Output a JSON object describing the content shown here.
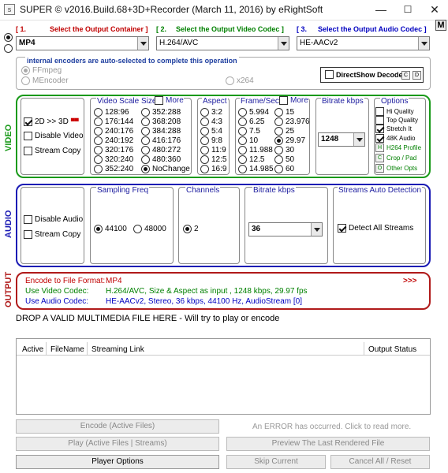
{
  "window": {
    "title": "SUPER © v2016.Build.68+3D+Recorder (March 11, 2016) by eRightSoft",
    "minimize": "—",
    "maximize": "☐",
    "close": "✕",
    "m_label": "M",
    "icon": "s"
  },
  "output_container": {
    "num": "[ 1.",
    "label": "Select the Output Container ]",
    "value": "MP4"
  },
  "video_codec": {
    "num": "[ 2.",
    "label": "Select the Output Video Codec ]",
    "value": "H.264/AVC"
  },
  "audio_codec": {
    "num": "[ 3.",
    "label": "Select the Output Audio Codec ]",
    "value": "HE-AACv2"
  },
  "encoders": {
    "title": "internal encoders are auto-selected to complete this operation",
    "ffmpeg": "FFmpeg",
    "mencoder": "MEncoder",
    "x264": "x264",
    "directshow": "DirectShow Decode",
    "mini_c": "C",
    "mini_d": "D"
  },
  "video": {
    "label": "VIDEO",
    "options": {
      "mode3d": "2D >> 3D",
      "disable": "Disable Video",
      "copy": "Stream Copy"
    },
    "scale": {
      "title": "Video Scale Size",
      "more": "More",
      "col1": [
        "128:96",
        "176:144",
        "240:176",
        "240:192",
        "320:176",
        "320:240",
        "352:240"
      ],
      "col2": [
        "352:288",
        "368:208",
        "384:288",
        "416:176",
        "480:272",
        "480:360",
        "NoChange"
      ]
    },
    "aspect": {
      "title": "Aspect",
      "values": [
        "3:2",
        "4:3",
        "5:4",
        "9:8",
        "11:9",
        "12:5",
        "16:9"
      ]
    },
    "framerate": {
      "title": "Frame/Sec",
      "more": "More",
      "col1": [
        "5.994",
        "6.25",
        "7.5",
        "10",
        "11.988",
        "12.5",
        "14.985"
      ],
      "col2": [
        "15",
        "23.976",
        "25",
        "29.97",
        "30",
        "50",
        "60"
      ]
    },
    "bitrate": {
      "title": "Bitrate  kbps",
      "value": "1248"
    },
    "opts": {
      "title": "Options",
      "hiq": "Hi Quality",
      "topq": "Top Quality",
      "stretch": "Stretch It",
      "audio48": "48K Audio",
      "h264": "H264 Profile",
      "crop": "Crop / Pad",
      "other": "Other Opts",
      "h": "H",
      "c": "C",
      "o": "O"
    }
  },
  "audio": {
    "label": "AUDIO",
    "disable": "Disable Audio",
    "copy": "Stream Copy",
    "freq": {
      "title": "Sampling Freq",
      "a": "44100",
      "b": "48000"
    },
    "channels": {
      "title": "Channels",
      "value": "2"
    },
    "bitrate": {
      "title": "Bitrate  kbps",
      "value": "36"
    },
    "streams": {
      "title": "Streams Auto Detection",
      "detect": "Detect All Streams"
    }
  },
  "output": {
    "label": "OUTPUT",
    "rows": [
      {
        "label": "Encode to File Format:",
        "value": "MP4"
      },
      {
        "label": "Use Video Codec:",
        "value": "H.264/AVC,   Size & Aspect as input ,   1248 kbps,   29.97 fps"
      },
      {
        "label": "Use Audio Codec:",
        "value": "HE-AACv2,   Stereo,   36 kbps,   44100 Hz,   AudioStream [0]"
      }
    ],
    "more": ">>>"
  },
  "drop_text": "DROP A VALID MULTIMEDIA FILE HERE - Will try to play or encode",
  "table": {
    "cols": [
      "Active",
      "FileName",
      "Streaming Link",
      "Output Status"
    ]
  },
  "buttons": {
    "encode": "Encode (Active Files)",
    "error": "An ERROR has occurred. Click to read more.",
    "play": "Play (Active Files | Streams)",
    "preview": "Preview The Last Rendered File",
    "player": "Player Options",
    "skip": "Skip Current",
    "cancel": "Cancel All   /   Reset"
  },
  "colors": {
    "video_border": "#1a9a1a",
    "audio_border": "#1a1ab4",
    "output_border": "#b01a1a",
    "header_red": "#c00000",
    "header_green": "#008000",
    "header_blue": "#0000c0",
    "output_green": "#008000",
    "output_red": "#c00000"
  }
}
